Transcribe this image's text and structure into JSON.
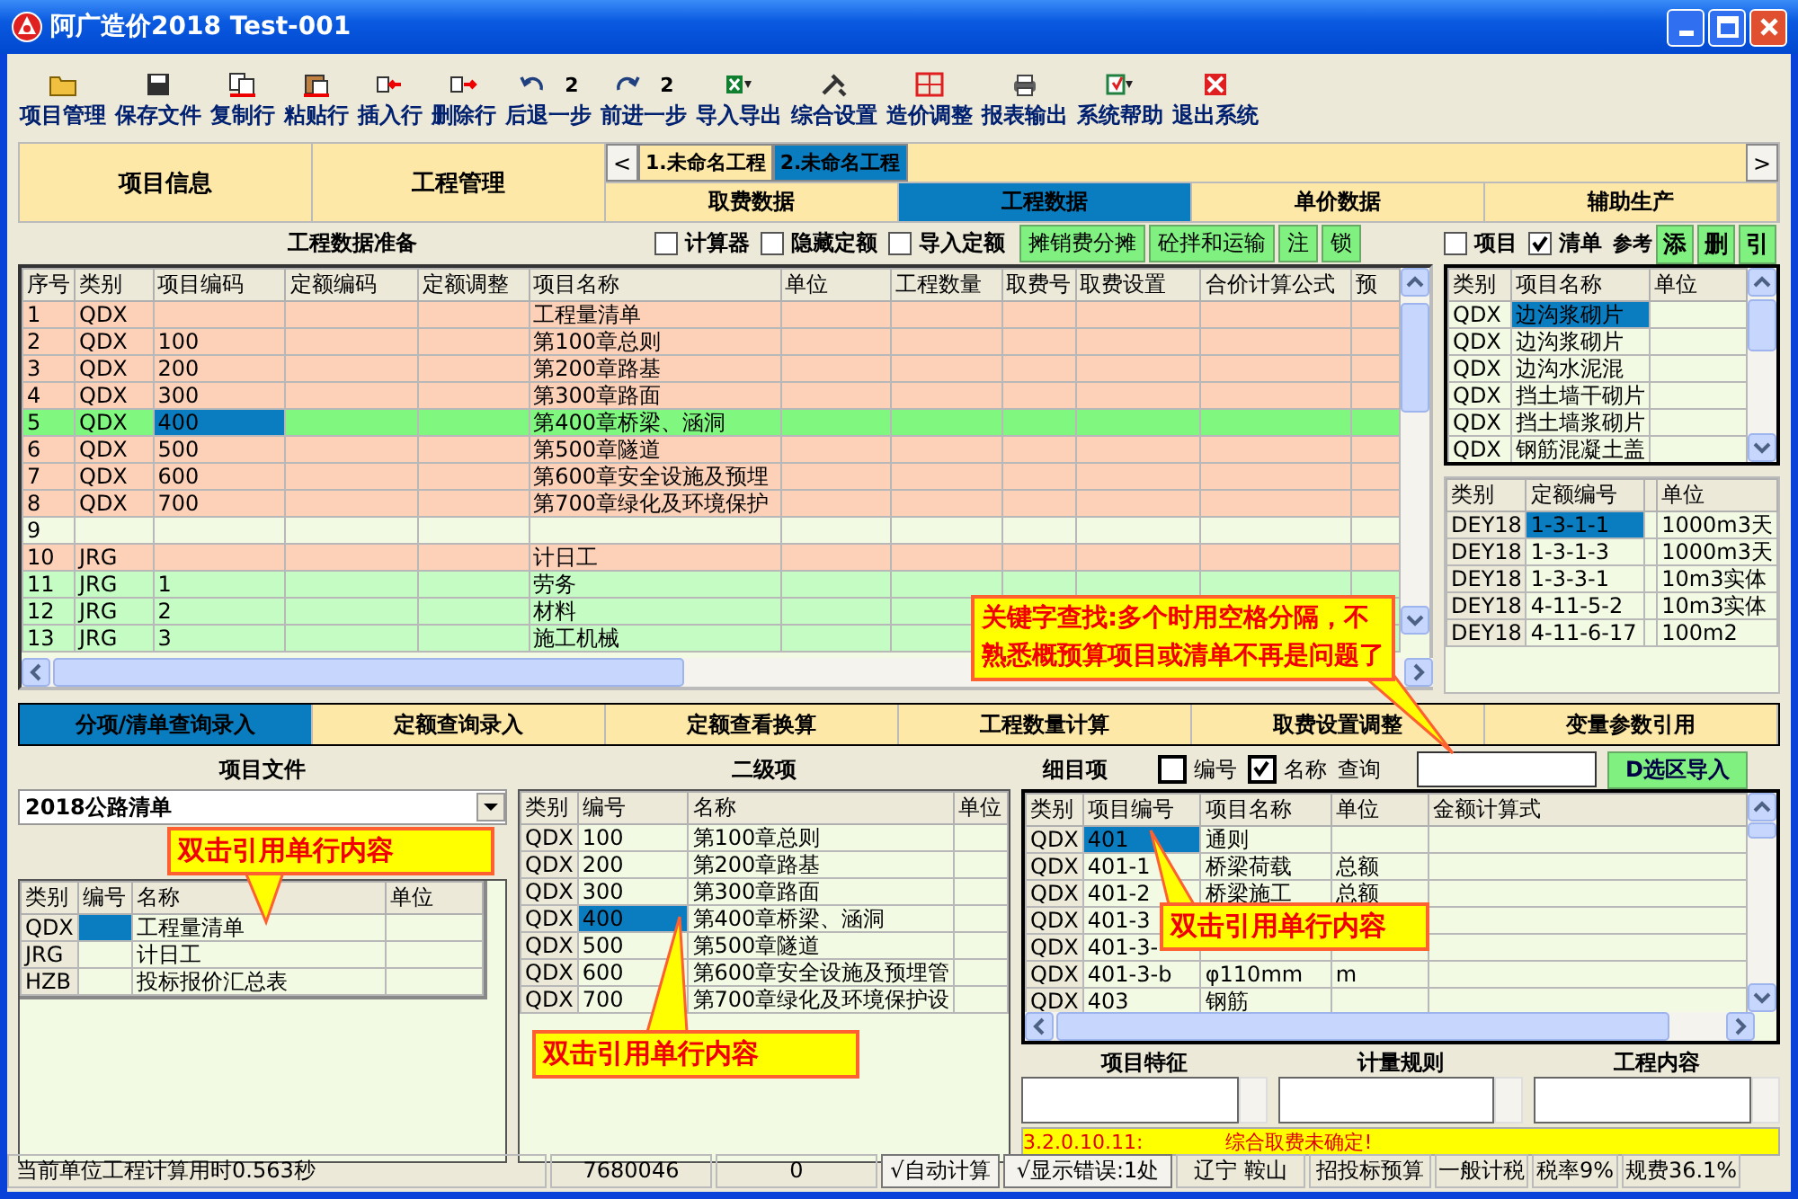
{
  "window": {
    "title": "阿广造价2018  Test-001"
  },
  "toolbar": [
    {
      "label": "项目管理"
    },
    {
      "label": "保存文件"
    },
    {
      "label": "复制行"
    },
    {
      "label": "粘贴行"
    },
    {
      "label": "插入行"
    },
    {
      "label": "删除行"
    },
    {
      "label": "后退一步",
      "count": "2"
    },
    {
      "label": "前进一步",
      "count": "2"
    },
    {
      "label": "导入导出"
    },
    {
      "label": "综合设置"
    },
    {
      "label": "造价调整"
    },
    {
      "label": "报表输出"
    },
    {
      "label": "系统帮助"
    },
    {
      "label": "退出系统"
    }
  ],
  "main_tabs": [
    {
      "label": "项目信息",
      "selected": false
    },
    {
      "label": "工程管理",
      "selected": false
    }
  ],
  "project_tabs": {
    "prev": "<",
    "next": ">",
    "items": [
      {
        "label": "1.未命名工程",
        "selected": false
      },
      {
        "label": "2.未命名工程",
        "selected": true
      }
    ]
  },
  "data_tabs": [
    {
      "label": "取费数据",
      "selected": false
    },
    {
      "label": "工程数据",
      "selected": true
    },
    {
      "label": "单价数据",
      "selected": false
    },
    {
      "label": "辅助生产",
      "selected": false
    }
  ],
  "prep": {
    "title": "工程数据准备",
    "options": [
      {
        "label": "计算器",
        "checked": false
      },
      {
        "label": "隐藏定额",
        "checked": false
      },
      {
        "label": "导入定额",
        "checked": false
      }
    ],
    "buttons": [
      "摊销费分摊",
      "砼拌和运输",
      "注",
      "锁"
    ],
    "table": {
      "columns": [
        "序号",
        "类别",
        "项目编码",
        "定额编码",
        "定额调整",
        "项目名称",
        "单位",
        "工程数量",
        "取费号",
        "取费设置",
        "合价计算公式",
        "预"
      ],
      "rows": [
        {
          "no": "1",
          "type": "QDX",
          "name": "工程量清单",
          "color": "#fdd0b8",
          "selected": false
        },
        {
          "no": "2",
          "type": "QDX",
          "code": "100",
          "name": "第100章总则",
          "color": "#fdd0b8",
          "selected": false
        },
        {
          "no": "3",
          "type": "QDX",
          "code": "200",
          "name": "第200章路基",
          "color": "#fdd0b8",
          "selected": false
        },
        {
          "no": "4",
          "type": "QDX",
          "code": "300",
          "name": "第300章路面",
          "color": "#fdd0b8",
          "selected": false
        },
        {
          "no": "5",
          "type": "QDX",
          "code": "400",
          "name": "第400章桥梁、涵洞",
          "color": "#80f880",
          "selected": true
        },
        {
          "no": "6",
          "type": "QDX",
          "code": "500",
          "name": "第500章隧道",
          "color": "#fdd0b8",
          "selected": false
        },
        {
          "no": "7",
          "type": "QDX",
          "code": "600",
          "name": "第600章安全设施及预埋",
          "color": "#fdd0b8",
          "selected": false
        },
        {
          "no": "8",
          "type": "QDX",
          "code": "700",
          "name": "第700章绿化及环境保护",
          "color": "#fdd0b8",
          "selected": false
        },
        {
          "no": "9",
          "color": "#f2fae4",
          "selected": false
        },
        {
          "no": "10",
          "type": "JRG",
          "name": "计日工",
          "color": "#fdd0b8",
          "selected": false
        },
        {
          "no": "11",
          "type": "JRG",
          "code": "1",
          "name": "劳务",
          "color": "#c4fcc4",
          "selected": false
        },
        {
          "no": "12",
          "type": "JRG",
          "code": "2",
          "name": "材料",
          "color": "#c4fcc4",
          "selected": false
        },
        {
          "no": "13",
          "type": "JRG",
          "code": "3",
          "name": "施工机械",
          "color": "#c4fcc4",
          "selected": false
        }
      ]
    }
  },
  "reference": {
    "options": [
      {
        "label": "项目",
        "checked": false
      },
      {
        "label": "清单",
        "checked": true
      }
    ],
    "label": "参考",
    "buttons": [
      "添",
      "删",
      "引"
    ],
    "list": {
      "columns": [
        "类别",
        "项目名称",
        "单位"
      ],
      "rows": [
        {
          "type": "QDX",
          "name": "边沟浆砌片",
          "selected": true
        },
        {
          "type": "QDX",
          "name": "边沟浆砌片",
          "selected": false
        },
        {
          "type": "QDX",
          "name": "边沟水泥混",
          "selected": false
        },
        {
          "type": "QDX",
          "name": "挡土墙干砌片",
          "selected": false
        },
        {
          "type": "QDX",
          "name": "挡土墙浆砌片",
          "selected": false
        },
        {
          "type": "QDX",
          "name": "钢筋混凝土盖",
          "selected": false
        }
      ]
    },
    "quota": {
      "columns": [
        "类别",
        "定额编号",
        "单位"
      ],
      "rows": [
        {
          "type": "DEY18",
          "code": "1-3-1-1",
          "unit": "1000m3天",
          "selected": true
        },
        {
          "type": "DEY18",
          "code": "1-3-1-3",
          "unit": "1000m3天",
          "selected": false
        },
        {
          "type": "DEY18",
          "code": "1-3-3-1",
          "unit": "10m3实体",
          "selected": false
        },
        {
          "type": "DEY18",
          "code": "4-11-5-2",
          "unit": "10m3实体",
          "selected": false
        },
        {
          "type": "DEY18",
          "code": "4-11-6-17",
          "unit": "100m2",
          "selected": false
        }
      ]
    }
  },
  "lower_tabs": [
    {
      "label": "分项/清单查询录入",
      "selected": true
    },
    {
      "label": "定额查询录入",
      "selected": false
    },
    {
      "label": "定额查看换算",
      "selected": false
    },
    {
      "label": "工程数量计算",
      "selected": false
    },
    {
      "label": "取费设置调整",
      "selected": false
    },
    {
      "label": "变量参数引用",
      "selected": false
    }
  ],
  "project_file": {
    "title": "项目文件",
    "dropdown": "2018公路清单",
    "table": {
      "columns": [
        "类别",
        "编号",
        "名称",
        "单位"
      ],
      "rows": [
        {
          "type": "QDX",
          "name": "工程量清单",
          "selected": true
        },
        {
          "type": "JRG",
          "name": "计日工",
          "selected": false
        },
        {
          "type": "HZB",
          "name": "投标报价汇总表",
          "selected": false
        }
      ]
    }
  },
  "second_level": {
    "title": "二级项",
    "table": {
      "columns": [
        "类别",
        "编号",
        "名称",
        "单位"
      ],
      "rows": [
        {
          "type": "QDX",
          "code": "100",
          "name": "第100章总则",
          "selected": false
        },
        {
          "type": "QDX",
          "code": "200",
          "name": "第200章路基",
          "selected": false
        },
        {
          "type": "QDX",
          "code": "300",
          "name": "第300章路面",
          "selected": false
        },
        {
          "type": "QDX",
          "code": "400",
          "name": "第400章桥梁、涵洞",
          "selected": true
        },
        {
          "type": "QDX",
          "code": "500",
          "name": "第500章隧道",
          "selected": false
        },
        {
          "type": "QDX",
          "code": "600",
          "name": "第600章安全设施及预埋管",
          "selected": false
        },
        {
          "type": "QDX",
          "code": "700",
          "name": "第700章绿化及环境保护设",
          "selected": false
        }
      ]
    }
  },
  "detail": {
    "title": "细目项",
    "options": [
      {
        "label": "编号",
        "checked": false
      },
      {
        "label": "名称",
        "checked": true
      }
    ],
    "search_label": "查询",
    "import_button": "D选区导入",
    "table": {
      "columns": [
        "类别",
        "项目编号",
        "项目名称",
        "单位",
        "金额计算式"
      ],
      "rows": [
        {
          "type": "QDX",
          "code": "401",
          "name": "通则",
          "selected": true
        },
        {
          "type": "QDX",
          "code": "401-1",
          "name": "桥梁荷载",
          "unit": "总额",
          "selected": false
        },
        {
          "type": "QDX",
          "code": "401-2",
          "name": "桥梁施工",
          "unit": "总额",
          "selected": false
        },
        {
          "type": "QDX",
          "code": "401-3",
          "selected": false
        },
        {
          "type": "QDX",
          "code": "401-3-",
          "selected": false
        },
        {
          "type": "QDX",
          "code": "401-3-b",
          "name": "φ110mm",
          "unit": "m",
          "selected": false
        },
        {
          "type": "QDX",
          "code": "403",
          "name": "钢筋",
          "selected": false
        }
      ]
    },
    "boxes": [
      "项目特征",
      "计量规则",
      "工程内容"
    ],
    "message": {
      "code": "3.2.0.10.11:",
      "text": "综合取费未确定!"
    }
  },
  "callouts": [
    "关键字查找:多个时用空格分隔，不熟悉概预算项目或清单不再是问题了",
    "双击引用单行内容",
    "双击引用单行内容",
    "双击引用单行内容"
  ],
  "status_bar": [
    "当前单位工程计算用时0.563秒",
    "7680046",
    "0",
    "√自动计算",
    "√显示错误:1处",
    "辽宁  鞍山",
    "招投标预算",
    "一般计税",
    "税率9%",
    "规费36.1%"
  ]
}
